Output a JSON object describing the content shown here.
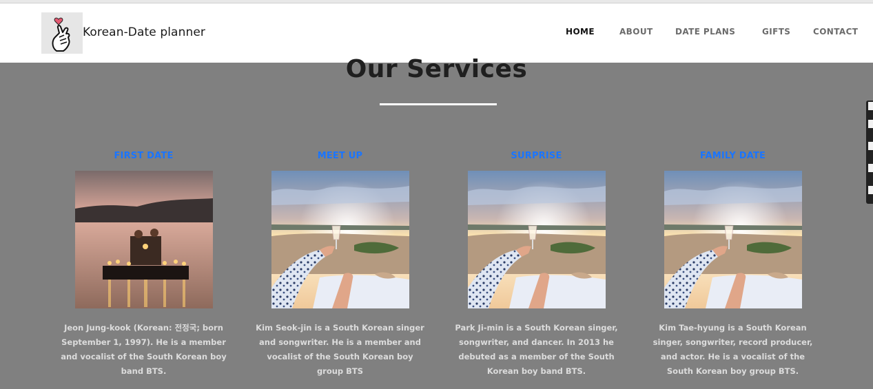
{
  "brand": {
    "name": "Korean-Date planner",
    "logo_icon": "finger-heart-icon"
  },
  "nav": {
    "items": [
      {
        "label": "HOME",
        "active": true
      },
      {
        "label": "ABOUT",
        "active": false
      },
      {
        "label": "DATE PLANS",
        "active": false
      },
      {
        "label": "GIFTS",
        "active": false
      },
      {
        "label": "CONTACT",
        "active": false
      }
    ]
  },
  "services": {
    "title": "Our Services",
    "cards": [
      {
        "title": "FIRST DATE",
        "image": "lake-dinner-photo",
        "text": "Jeon Jung-kook (Korean: 전정국; born September 1, 1997). He is a member and vocalist of the South Korean boy band BTS."
      },
      {
        "title": "MEET UP",
        "image": "beach-sunset-photo",
        "text": "Kim Seok-jin is a South Korean singer and songwriter. He is a member and vocalist of the South Korean boy group BTS"
      },
      {
        "title": "SURPRISE",
        "image": "beach-sunset-photo",
        "text": "Park Ji-min is a South Korean singer, songwriter, and dancer. In 2013 he debuted as a member of the South Korean boy band BTS."
      },
      {
        "title": "FAMILY DATE",
        "image": "beach-sunset-photo",
        "text": "Kim Tae-hyung is a South Korean singer, songwriter, record producer, and actor. He is a vocalist of the South Korean boy group BTS."
      }
    ]
  },
  "colors": {
    "accent": "#1a75ff",
    "background": "#808080",
    "navbar": "#ffffff"
  }
}
